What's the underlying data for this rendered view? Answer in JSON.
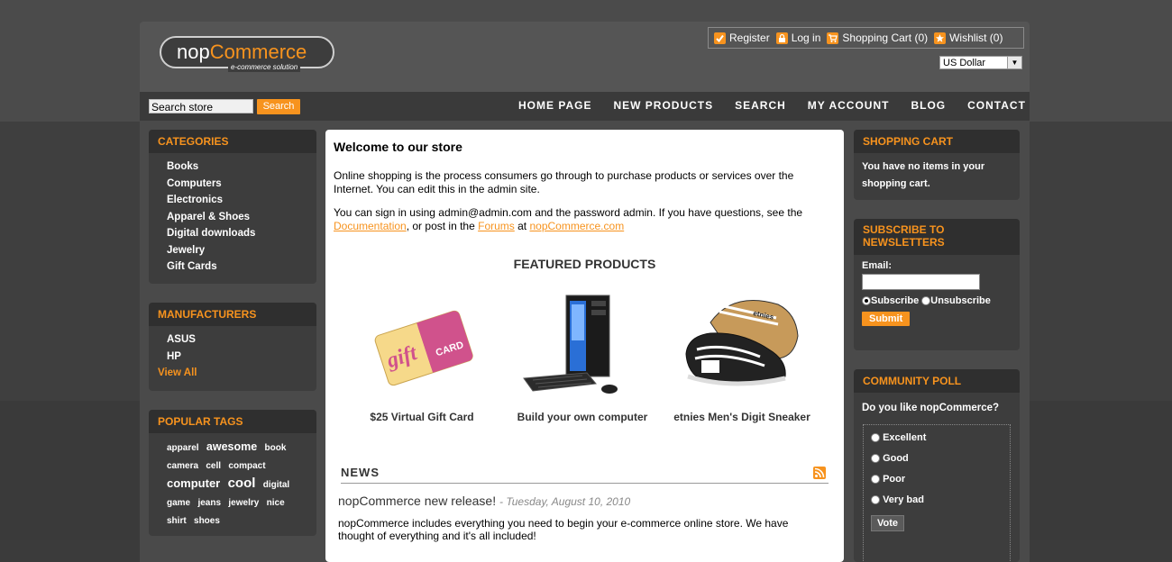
{
  "header": {
    "logo_main": "nop",
    "logo_accent": "Commerce",
    "logo_tagline": "e-commerce solution",
    "links": {
      "register": "Register",
      "login": "Log in",
      "cart": "Shopping Cart (0)",
      "wishlist": "Wishlist (0)"
    },
    "currency": "US Dollar"
  },
  "search": {
    "placeholder": "Search store",
    "button": "Search"
  },
  "menu": {
    "home": "HOME PAGE",
    "new_products": "NEW PRODUCTS",
    "search": "SEARCH",
    "my_account": "MY ACCOUNT",
    "blog": "BLOG",
    "contact": "CONTACT US"
  },
  "categories": {
    "title": "CATEGORIES",
    "items": [
      "Books",
      "Computers",
      "Electronics",
      "Apparel & Shoes",
      "Digital downloads",
      "Jewelry",
      "Gift Cards"
    ]
  },
  "manufacturers": {
    "title": "MANUFACTURERS",
    "items": [
      "ASUS",
      "HP"
    ],
    "view_all": "View All"
  },
  "tags": {
    "title": "POPULAR TAGS",
    "items": [
      "apparel",
      "awesome",
      "book",
      "camera",
      "cell",
      "compact",
      "computer",
      "cool",
      "digital",
      "game",
      "jeans",
      "jewelry",
      "nice",
      "shirt",
      "shoes"
    ]
  },
  "welcome": {
    "title": "Welcome to our store",
    "p1": "Online shopping is the process consumers go through to purchase products or services over the Internet. You can edit this in the admin site.",
    "p2_prefix": "You can sign in using admin@admin.com and the password admin. If you have questions, see the",
    "doc_link": "Documentation",
    "p2_mid": ", or post in the",
    "forums_link": "Forums",
    "p2_at": "at",
    "site_link": "nopCommerce.com"
  },
  "featured": {
    "title": "FEATURED PRODUCTS",
    "products": [
      {
        "name": "$25 Virtual Gift Card",
        "card_text_1": "gift",
        "card_text_2": "CARD"
      },
      {
        "name": "Build your own computer"
      },
      {
        "name": "etnies Men's Digit Sneaker",
        "shoe_brand": "etnies"
      }
    ]
  },
  "news": {
    "title": "NEWS",
    "item_title": "nopCommerce new release!",
    "item_date": "- Tuesday, August 10, 2010",
    "item_body": "nopCommerce includes everything you need to begin your e-commerce online store. We have thought of everything and it's all included!"
  },
  "shopping_cart": {
    "title": "SHOPPING CART",
    "text": "You have no items in your shopping cart."
  },
  "newsletter": {
    "title": "SUBSCRIBE TO NEWSLETTERS",
    "email_label": "Email:",
    "subscribe": "Subscribe",
    "unsubscribe": "Unsubscribe",
    "submit": "Submit"
  },
  "poll": {
    "title": "COMMUNITY POLL",
    "question": "Do you like nopCommerce?",
    "options": [
      "Excellent",
      "Good",
      "Poor",
      "Very bad"
    ],
    "vote": "Vote"
  },
  "colors": {
    "accent": "#f7931e",
    "page_bg": "#3b3b3b",
    "box_header": "#2f2f2f"
  }
}
